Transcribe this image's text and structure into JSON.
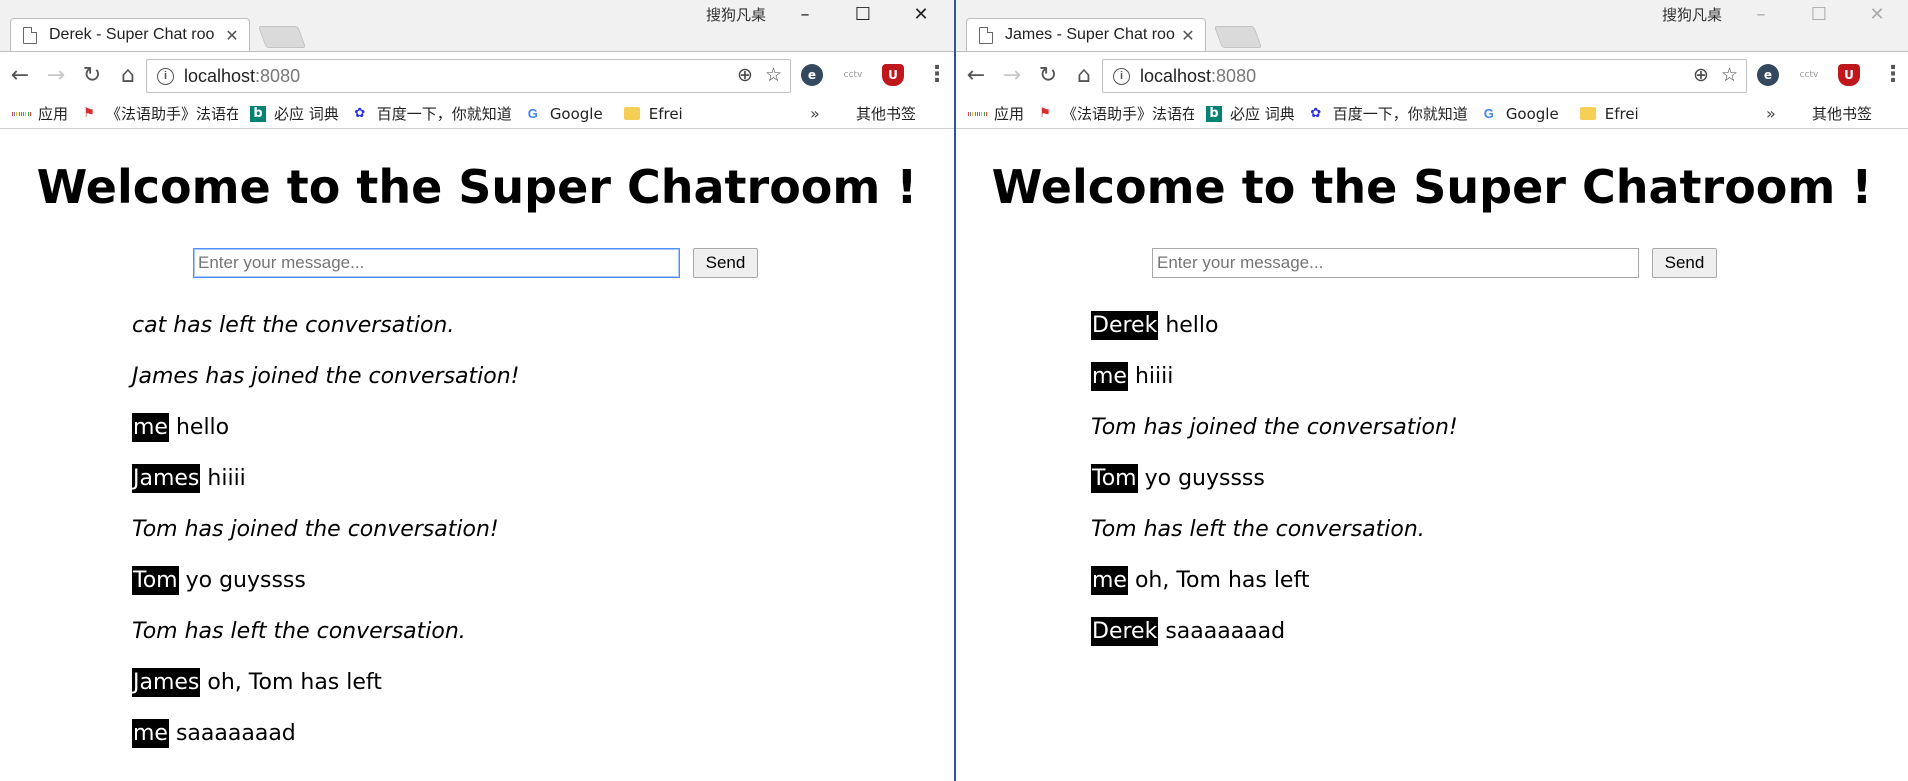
{
  "windows": [
    {
      "tab_title": "Derek - Super Chat roo",
      "ime_label": "搜狗凡桌",
      "url_host": "localhost",
      "url_port": ":8080",
      "bookmarks": [
        "应用",
        "《法语助手》法语在",
        "必应 词典",
        "百度一下，你就知道",
        "Google",
        "Efrei"
      ],
      "bookmarks_more": "»",
      "bookmarks_other": "其他书签",
      "heading": "Welcome to the Super Chatroom !",
      "input_placeholder": "Enter your message...",
      "send_label": "Send",
      "messages": [
        {
          "type": "system",
          "text": "cat has left the conversation."
        },
        {
          "type": "system",
          "text": "James has joined the conversation!"
        },
        {
          "type": "chat",
          "author": "me",
          "text": "hello"
        },
        {
          "type": "chat",
          "author": "James",
          "text": "hiiii"
        },
        {
          "type": "system",
          "text": "Tom has joined the conversation!"
        },
        {
          "type": "chat",
          "author": "Tom",
          "text": "yo guyssss"
        },
        {
          "type": "system",
          "text": "Tom has left the conversation."
        },
        {
          "type": "chat",
          "author": "James",
          "text": "oh, Tom has left"
        },
        {
          "type": "chat",
          "author": "me",
          "text": "saaaaaaad"
        }
      ]
    },
    {
      "tab_title": "James - Super Chat roo",
      "ime_label": "搜狗凡桌",
      "url_host": "localhost",
      "url_port": ":8080",
      "bookmarks": [
        "应用",
        "《法语助手》法语在",
        "必应 词典",
        "百度一下，你就知道",
        "Google",
        "Efrei"
      ],
      "bookmarks_more": "»",
      "bookmarks_other": "其他书签",
      "heading": "Welcome to the Super Chatroom !",
      "input_placeholder": "Enter your message...",
      "send_label": "Send",
      "messages": [
        {
          "type": "chat",
          "author": "Derek",
          "text": "hello"
        },
        {
          "type": "chat",
          "author": "me",
          "text": "hiiii"
        },
        {
          "type": "system",
          "text": "Tom has joined the conversation!"
        },
        {
          "type": "chat",
          "author": "Tom",
          "text": "yo guyssss"
        },
        {
          "type": "system",
          "text": "Tom has left the conversation."
        },
        {
          "type": "chat",
          "author": "me",
          "text": "oh, Tom has left"
        },
        {
          "type": "chat",
          "author": "Derek",
          "text": "saaaaaaad"
        }
      ]
    }
  ],
  "icons": {
    "back": "arrow-left-icon",
    "forward": "arrow-right-icon",
    "reload": "reload-icon",
    "home": "home-icon",
    "info": "info-icon",
    "zoom": "zoom-icon",
    "star": "star-icon",
    "menu": "more-vert-icon"
  },
  "colors": {
    "author_bg": "#000000",
    "author_fg": "#ffffff",
    "focus_border": "#4d90fe",
    "window_divider": "#2b5797"
  }
}
